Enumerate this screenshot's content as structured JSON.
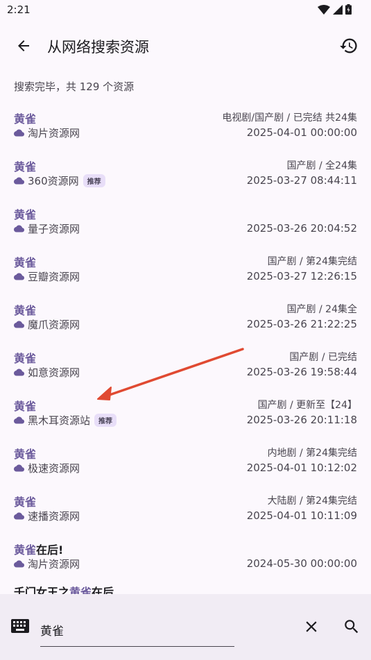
{
  "status": {
    "time": "2:21"
  },
  "header": {
    "title": "从网络搜索资源"
  },
  "summary": "搜索完毕，共 129 个资源",
  "results": [
    {
      "title_hl": "黄雀",
      "title_rest": "",
      "source": "淘片资源网",
      "badge": "",
      "meta": "电视剧/国产剧 / 已完结 共24集",
      "date": "2025-04-01 00:00:00"
    },
    {
      "title_hl": "黄雀",
      "title_rest": "",
      "source": "360资源网",
      "badge": "推荐",
      "meta": "国产剧 / 全24集",
      "date": "2025-03-27 08:44:11"
    },
    {
      "title_hl": "黄雀",
      "title_rest": "",
      "source": "量子资源网",
      "badge": "",
      "meta": "",
      "date": "2025-03-26 20:04:52"
    },
    {
      "title_hl": "黄雀",
      "title_rest": "",
      "source": "豆瓣资源网",
      "badge": "",
      "meta": "国产剧 / 第24集完结",
      "date": "2025-03-27 12:26:15"
    },
    {
      "title_hl": "黄雀",
      "title_rest": "",
      "source": "魔爪资源网",
      "badge": "",
      "meta": "国产剧 / 24集全",
      "date": "2025-03-26 21:22:25"
    },
    {
      "title_hl": "黄雀",
      "title_rest": "",
      "source": "如意资源网",
      "badge": "",
      "meta": "国产剧 / 已完结",
      "date": "2025-03-26 19:58:44"
    },
    {
      "title_hl": "黄雀",
      "title_rest": "",
      "source": "黑木耳资源站",
      "badge": "推荐",
      "meta": "国产剧 / 更新至【24】",
      "date": "2025-03-26 20:11:18"
    },
    {
      "title_hl": "黄雀",
      "title_rest": "",
      "source": "极速资源网",
      "badge": "",
      "meta": "内地剧 / 第24集完结",
      "date": "2025-04-01 10:12:02"
    },
    {
      "title_hl": "黄雀",
      "title_rest": "",
      "source": "速播资源网",
      "badge": "",
      "meta": "大陆剧 / 第24集完结",
      "date": "2025-04-01 10:11:09"
    },
    {
      "title_hl": "黄雀",
      "title_rest": "在后!",
      "source": "淘片资源网",
      "badge": "",
      "meta": "",
      "date": "2024-05-30 00:00:00"
    }
  ],
  "partial_row": {
    "prefix": "千门女王之",
    "hl": "黄雀",
    "suffix": "在后"
  },
  "search": {
    "value": "黄雀"
  },
  "colors": {
    "accent": "#6b5a9c",
    "annotation_arrow": "#e04a32"
  }
}
